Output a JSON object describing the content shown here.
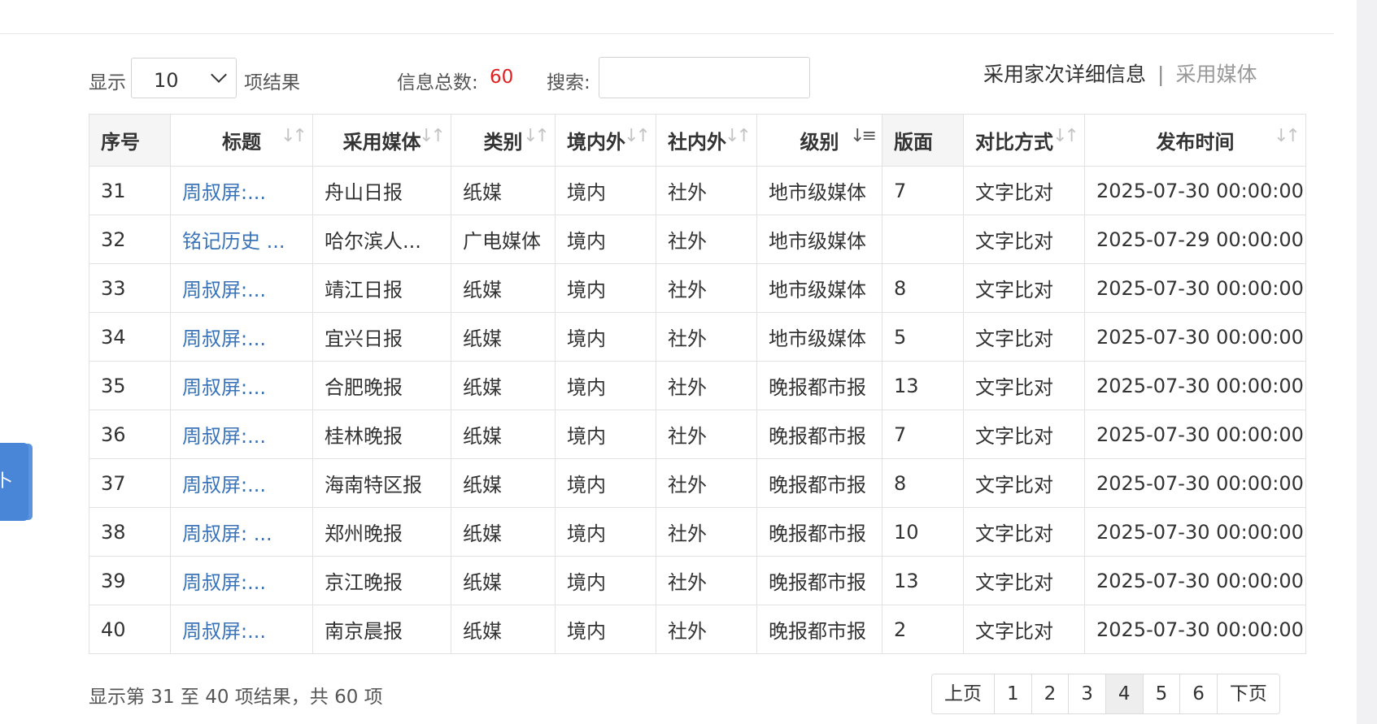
{
  "toolbar": {
    "show_label": "显示",
    "page_size": "10",
    "results_label": "项结果",
    "total_label": "信息总数:",
    "total_count": "60",
    "search_label": "搜索:",
    "search_value": "",
    "link_details": "采用家次详细信息",
    "link_separator": "|",
    "link_media": "采用媒体"
  },
  "table": {
    "columns": [
      "序号",
      "标题",
      "采用媒体",
      "类别",
      "境内外",
      "社内外",
      "级别",
      "版面",
      "对比方式",
      "发布时间"
    ],
    "rows": [
      [
        "31",
        "周叔屏:...",
        "舟山日报",
        "纸媒",
        "境内",
        "社外",
        "地市级媒体",
        "7",
        "文字比对",
        "2025-07-30 00:00:00"
      ],
      [
        "32",
        "铭记历史 ...",
        "哈尔滨人...",
        "广电媒体",
        "境内",
        "社外",
        "地市级媒体",
        "",
        "文字比对",
        "2025-07-29 00:00:00"
      ],
      [
        "33",
        "周叔屏:...",
        "靖江日报",
        "纸媒",
        "境内",
        "社外",
        "地市级媒体",
        "8",
        "文字比对",
        "2025-07-30 00:00:00"
      ],
      [
        "34",
        "周叔屏:...",
        "宜兴日报",
        "纸媒",
        "境内",
        "社外",
        "地市级媒体",
        "5",
        "文字比对",
        "2025-07-30 00:00:00"
      ],
      [
        "35",
        "周叔屏:...",
        "合肥晚报",
        "纸媒",
        "境内",
        "社外",
        "晚报都市报",
        "13",
        "文字比对",
        "2025-07-30 00:00:00"
      ],
      [
        "36",
        "周叔屏:...",
        "桂林晚报",
        "纸媒",
        "境内",
        "社外",
        "晚报都市报",
        "7",
        "文字比对",
        "2025-07-30 00:00:00"
      ],
      [
        "37",
        "周叔屏:...",
        "海南特区报",
        "纸媒",
        "境内",
        "社外",
        "晚报都市报",
        "8",
        "文字比对",
        "2025-07-30 00:00:00"
      ],
      [
        "38",
        "周叔屏: ...",
        "郑州晚报",
        "纸媒",
        "境内",
        "社外",
        "晚报都市报",
        "10",
        "文字比对",
        "2025-07-30 00:00:00"
      ],
      [
        "39",
        "周叔屏:...",
        "京江晚报",
        "纸媒",
        "境内",
        "社外",
        "晚报都市报",
        "13",
        "文字比对",
        "2025-07-30 00:00:00"
      ],
      [
        "40",
        "周叔屏:...",
        "南京晨报",
        "纸媒",
        "境内",
        "社外",
        "晚报都市报",
        "2",
        "文字比对",
        "2025-07-30 00:00:00"
      ]
    ]
  },
  "footer": {
    "info": "显示第 31 至 40 项结果，共 60 项",
    "prev": "上页",
    "pages": [
      "1",
      "2",
      "3",
      "4",
      "5",
      "6"
    ],
    "current_page": "4",
    "next": "下页"
  },
  "side_tab": {
    "label": "卜"
  },
  "colors": {
    "link": "#3a73b8",
    "count": "#e02020",
    "side_tab": "#4a86d8"
  }
}
